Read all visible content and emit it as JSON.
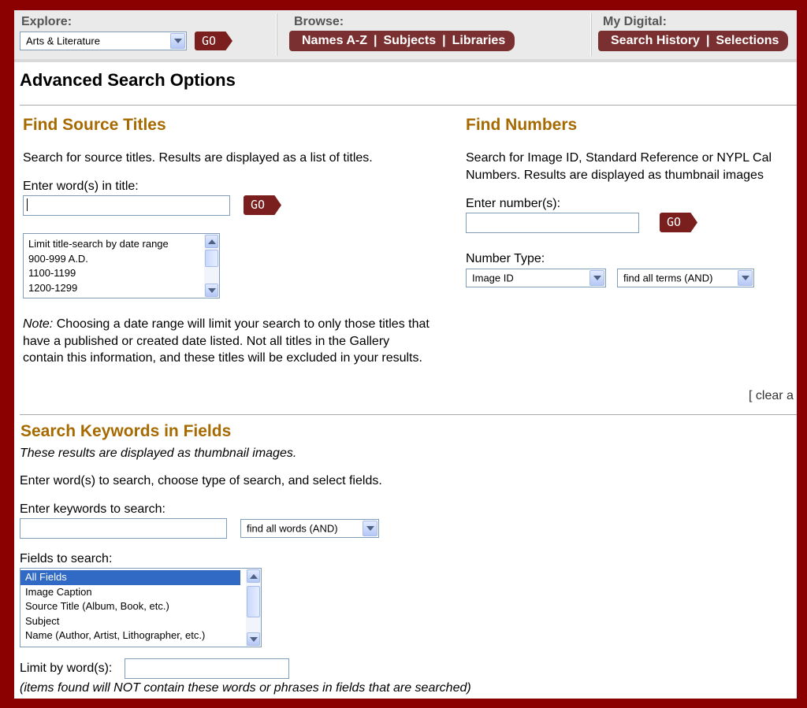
{
  "nav": {
    "explore_label": "Explore:",
    "explore_value": "Arts & Literature",
    "go_label": "GO",
    "browse_label": "Browse:",
    "browse_links": [
      "Names A-Z",
      "Subjects",
      "Libraries"
    ],
    "mydigital_label": "My Digital:",
    "mydigital_links": [
      "Search History",
      "Selections"
    ]
  },
  "page_title": "Advanced Search Options",
  "source_titles": {
    "title": "Find Source Titles",
    "description": "Search for source titles. Results are displayed as a list of titles.",
    "input_label": "Enter word(s) in title:",
    "input_value": "",
    "go_label": "GO",
    "date_list": [
      "Limit title-search by date range",
      "900-999 A.D.",
      "1100-1199",
      "1200-1299"
    ],
    "note_label": "Note:",
    "note_text": "Choosing a date range will limit your search to only those titles that have a published or created date listed. Not all titles in the Gallery contain this information, and these titles will be excluded in your results."
  },
  "numbers": {
    "title": "Find Numbers",
    "description_line1": "Search for Image ID, Standard Reference or NYPL Cal",
    "description_line2": "Numbers. Results are displayed as thumbnail images",
    "input_label": "Enter number(s):",
    "input_value": "",
    "go_label": "GO",
    "type_label": "Number Type:",
    "type_value": "Image ID",
    "match_value": "find all terms (AND)",
    "clear_link": "[ clear a"
  },
  "keywords": {
    "title": "Search Keywords in Fields",
    "subtitle": "These results are displayed as thumbnail images.",
    "instructions": "Enter word(s) to search, choose type of search, and select fields.",
    "input_label": "Enter keywords to search:",
    "input_value": "",
    "match_value": "find all words (AND)",
    "fields_label": "Fields to search:",
    "fields": [
      "All Fields",
      "Image Caption",
      "Source Title (Album, Book, etc.)",
      "Subject",
      "Name (Author, Artist, Lithographer, etc.)"
    ],
    "selected_field": "All Fields",
    "limit_label": "Limit by word(s):",
    "limit_value": "",
    "limit_note": "(items found will NOT contain these words or phrases in fields that are searched)"
  },
  "colors": {
    "frame": "#8b0000",
    "accent_title": "#a66a00",
    "button": "#7a1e1e",
    "selection": "#316ac5"
  }
}
